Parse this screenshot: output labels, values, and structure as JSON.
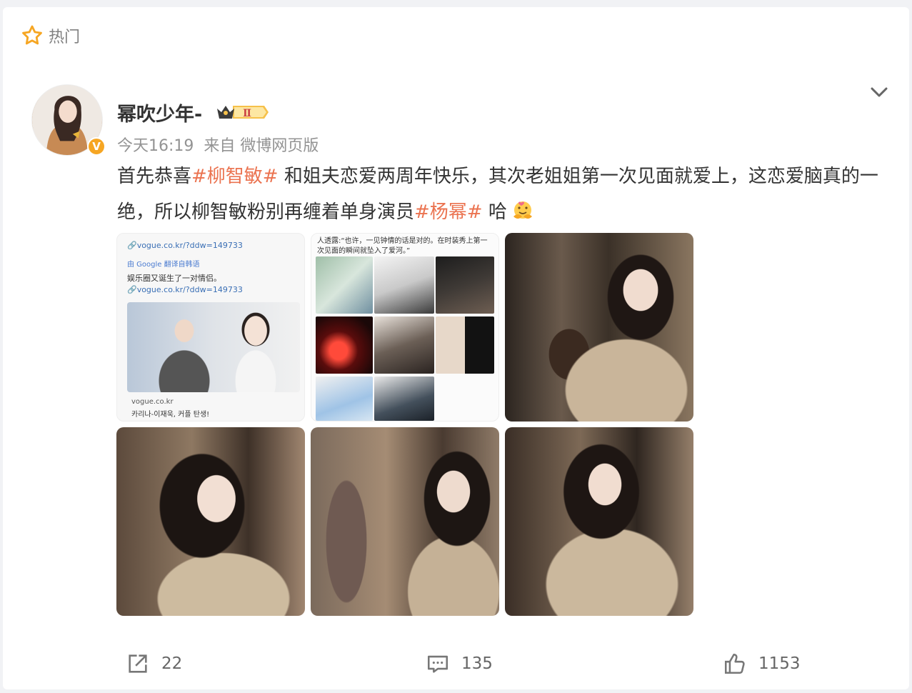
{
  "hot": {
    "label": "热门",
    "icon": "star-outline-icon"
  },
  "post": {
    "username": "幂吹少年-",
    "badge": "Ⅱ",
    "time": "今天16:19",
    "source": "来自 微博网页版",
    "content": {
      "part1": "首先恭喜",
      "tag1": "#柳智敏#",
      "part2": " 和姐夫恋爱两周年快乐，其次老姐姐第一次见面就爱上，这恋爱脑真的一绝，所以柳智敏粉别再缠着单身演员",
      "tag2": "#杨幂#",
      "part3": " 哈"
    },
    "images": {
      "img1": {
        "url": "🔗vogue.co.kr/?ddw=149733",
        "translate": "由 Google 翻译自韩语",
        "text": "娱乐圈又诞生了一对情侣。",
        "url2": "🔗vogue.co.kr/?ddw=149733",
        "caption_source": "vogue.co.kr",
        "caption_title": "카리나-이재욱, 커플 탄생!"
      },
      "img2": {
        "quote": "人透露:“也许，一见钟情的话是对的。在时装秀上第一次见面的瞬间就坠入了爱河。”"
      }
    }
  },
  "actions": {
    "repost_count": "22",
    "comment_count": "135",
    "like_count": "1153"
  },
  "colors": {
    "tag": "#eb7350",
    "badge_gold": "#f6a623"
  }
}
